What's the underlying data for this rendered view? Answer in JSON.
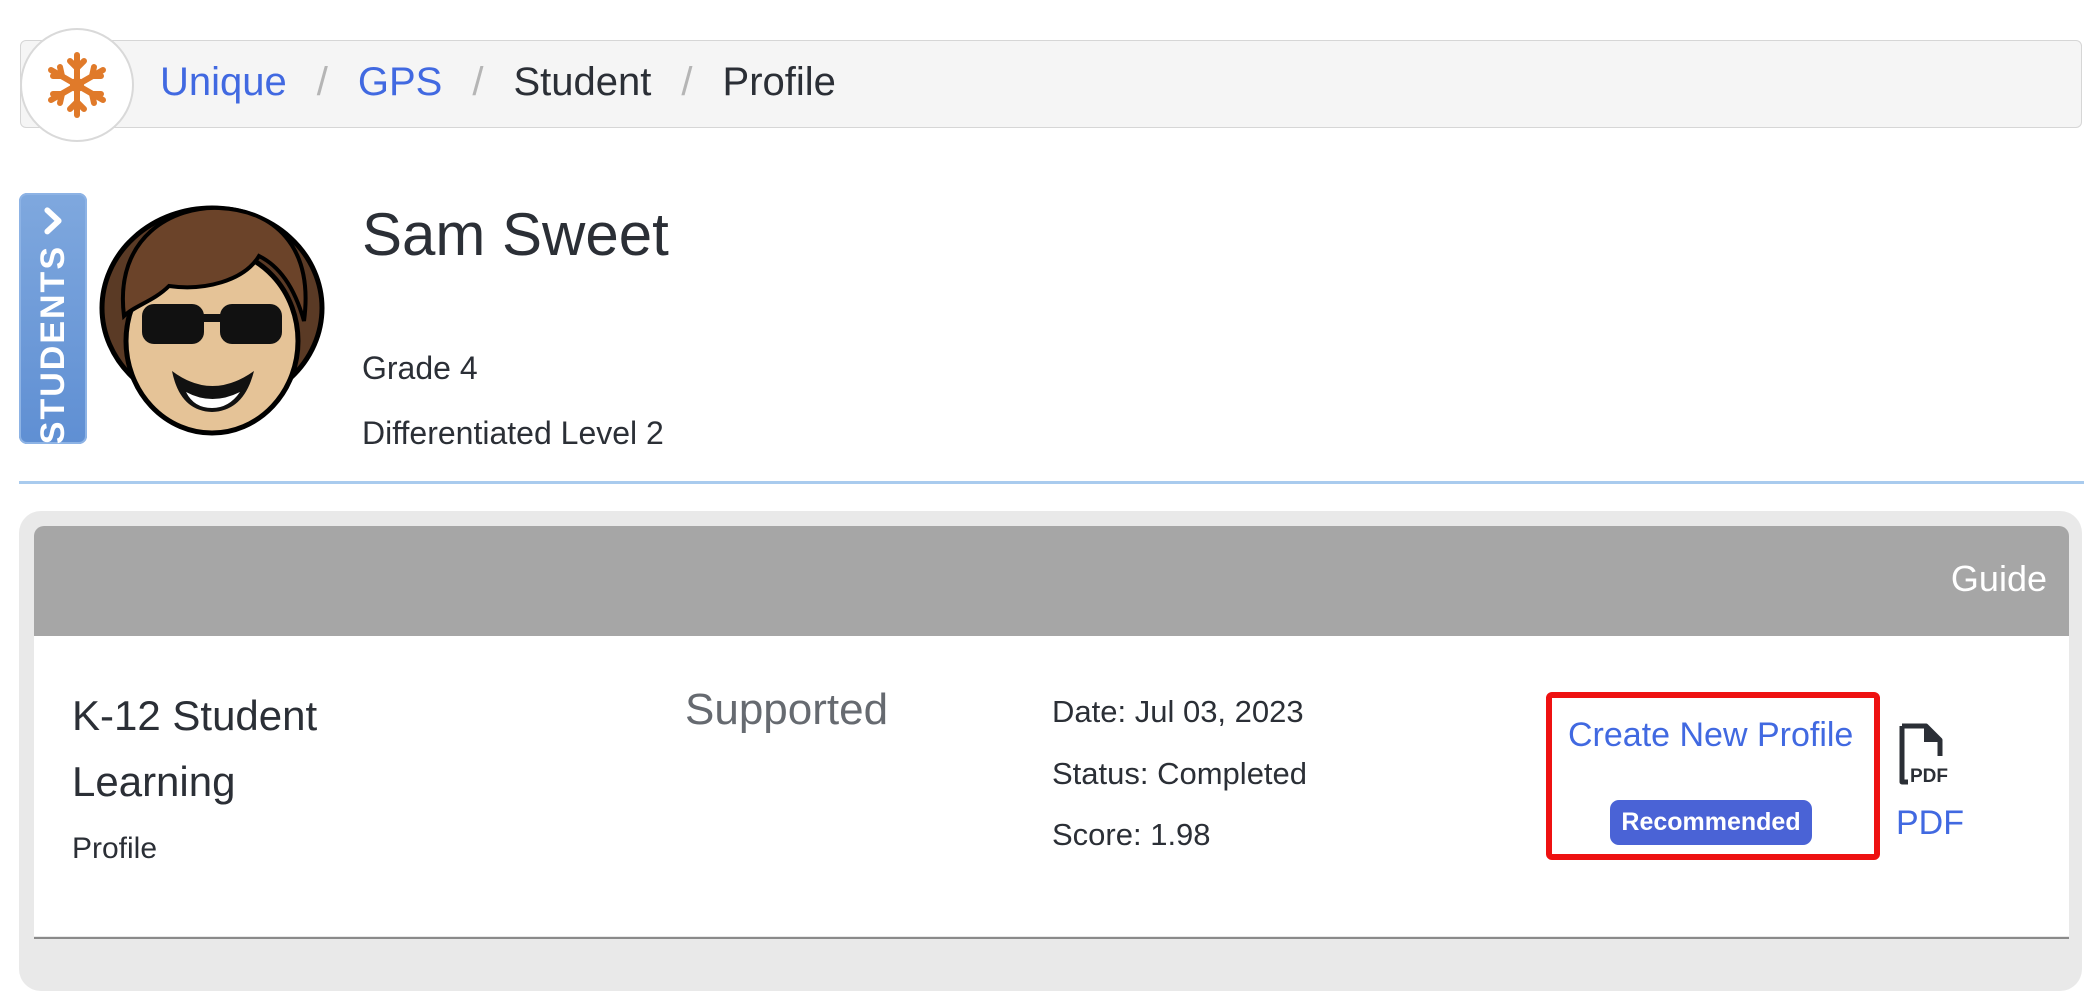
{
  "breadcrumb": {
    "items": [
      {
        "label": "Unique",
        "link": true
      },
      {
        "label": "GPS",
        "link": true
      },
      {
        "label": "Student",
        "link": false
      },
      {
        "label": "Profile",
        "link": false
      }
    ],
    "separator": "/"
  },
  "sidebar_tab": {
    "label": "STUDENTS"
  },
  "student": {
    "name": "Sam Sweet",
    "grade": "Grade 4",
    "level": "Differentiated Level 2"
  },
  "card": {
    "header_label": "Guide",
    "row": {
      "title": "K-12 Student Learning",
      "subtitle": "Profile",
      "support": "Supported",
      "date": "Date: Jul 03, 2023",
      "status": "Status: Completed",
      "score": "Score: 1.98",
      "create_label": "Create New Profile",
      "badge": "Recommended",
      "pdf_label": "PDF",
      "pdf_icon_text": "PDF"
    }
  },
  "colors": {
    "link": "#4169e1",
    "badge": "#4a63d6",
    "highlight": "#ee1111",
    "header_gray": "#a6a6a6",
    "snowflake": "#e07a2a"
  },
  "icons": {
    "logo": "snowflake-icon",
    "tab": "chevron-right-icon",
    "pdf": "pdf-file-icon"
  }
}
